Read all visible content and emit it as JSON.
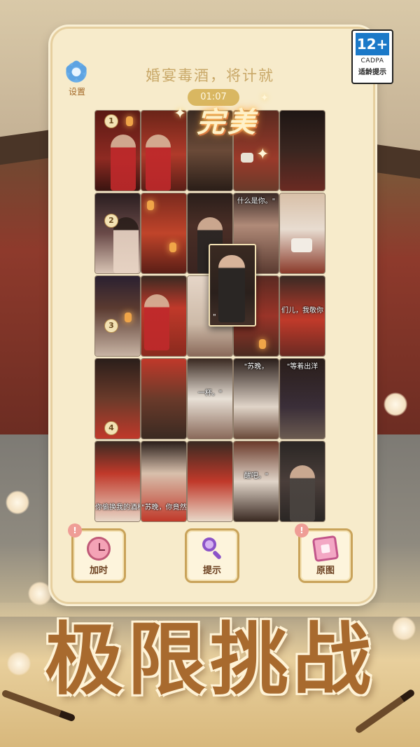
{
  "settings": {
    "label": "设置",
    "icon": "gear-icon"
  },
  "level": {
    "title": "婚宴毒酒，将计就",
    "timer": "01:07"
  },
  "feedback": {
    "perfect_text": "完美"
  },
  "age_rating": {
    "rating": "12+",
    "org": "CADPA",
    "tip": "适龄提示"
  },
  "puzzle": {
    "row_markers": [
      "1",
      "2",
      "3",
      "4"
    ],
    "captions": {
      "r1c4": "什么是你。\"",
      "r3c5": "\"苏晚，",
      "r3c6": "\"等着出洋",
      "r3c3": "一杯。\"",
      "r2c5": "们儿，我敬你",
      "r4c1": "你偷换我的酒杯",
      "r4c2": "\"苏晚，你竟然",
      "r4c4": "醒吧。\"",
      "floating": "\""
    }
  },
  "tools": {
    "add_time": {
      "label": "加时",
      "badge": "!",
      "icon": "alarm-clock-icon"
    },
    "hint": {
      "label": "提示",
      "badge": "",
      "icon": "magnifier-icon"
    },
    "original": {
      "label": "原图",
      "badge": "!",
      "icon": "picture-icon"
    }
  },
  "promo": {
    "slogan": "极限挑战"
  },
  "colors": {
    "panel": "#f7ebcb",
    "accent": "#c9a35a",
    "title_text": "#c9a868",
    "slogan": "#a86a2e"
  }
}
